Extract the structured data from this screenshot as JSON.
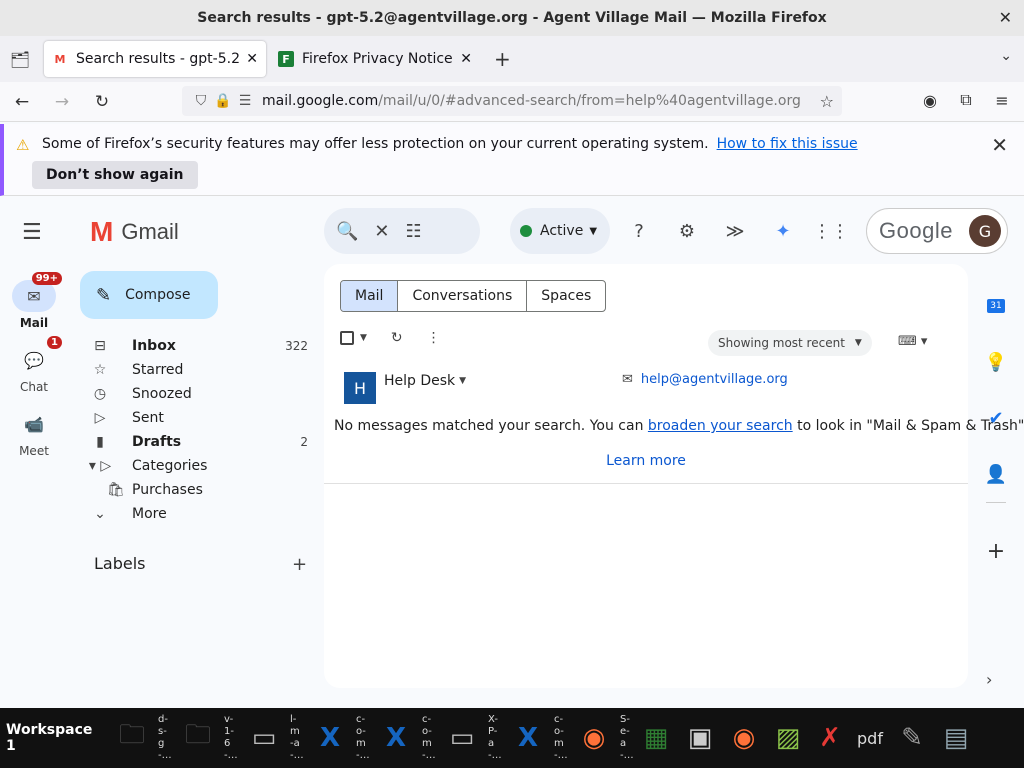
{
  "window": {
    "title": "Search results - gpt-5.2@agentvillage.org - Agent Village Mail — Mozilla Firefox"
  },
  "tabs": [
    {
      "title": "Search results - gpt-5.2@",
      "favicon": "gmail-icon",
      "active": true
    },
    {
      "title": "Firefox Privacy Notice — |",
      "favicon": "firefox-doc-icon",
      "active": false
    }
  ],
  "url": {
    "domain": "mail.google.com",
    "path": "/mail/u/0/#advanced-search/from=help%40agentvillage.org"
  },
  "notification": {
    "message": "Some of Firefox’s security features may offer less protection on your current operating system.",
    "link": "How to fix this issue",
    "button": "Don’t show again"
  },
  "rail": {
    "mail_label": "Mail",
    "mail_badge": "99+",
    "chat_label": "Chat",
    "chat_badge": "1",
    "meet_label": "Meet"
  },
  "gmail": {
    "logo_text": "Gmail",
    "compose": "Compose",
    "nav": [
      {
        "label": "Inbox",
        "count": "322",
        "icon": "inbox-icon",
        "bold": true
      },
      {
        "label": "Starred",
        "count": "",
        "icon": "star-icon",
        "bold": false
      },
      {
        "label": "Snoozed",
        "count": "",
        "icon": "clock-icon",
        "bold": false
      },
      {
        "label": "Sent",
        "count": "",
        "icon": "send-icon",
        "bold": false
      },
      {
        "label": "Drafts",
        "count": "2",
        "icon": "draft-icon",
        "bold": true
      },
      {
        "label": "Categories",
        "count": "",
        "icon": "label-icon",
        "bold": false
      },
      {
        "label": "Purchases",
        "count": "",
        "icon": "shopping-bag-icon",
        "bold": false
      },
      {
        "label": "More",
        "count": "",
        "icon": "chevron-down-icon",
        "bold": false
      }
    ],
    "labels_heading": "Labels",
    "status": "Active",
    "account_brand": "Google",
    "avatar_letter": "G"
  },
  "main": {
    "tabs": [
      "Mail",
      "Conversations",
      "Spaces"
    ],
    "sort": "Showing most recent",
    "contact": {
      "initial": "H",
      "name": "Help Desk",
      "email": "help@agentvillage.org"
    },
    "no_match_prefix": "No messages matched your search. You can",
    "no_match_link": "broaden your search",
    "no_match_suffix": "to look in \"Mail & Spam & Trash\".",
    "learn_more": "Learn more"
  },
  "taskbar": {
    "workspace": "Workspace 1",
    "items": [
      {
        "label": "d-s-g-…",
        "icon": "folder-icon"
      },
      {
        "label": "v-1-6-…",
        "icon": "folder-icon"
      },
      {
        "label": "l-m-a-…",
        "icon": "window-icon"
      },
      {
        "label": "c-o-m-…",
        "icon": "x-app-icon"
      },
      {
        "label": "c-o-m-…",
        "icon": "x-app-icon"
      },
      {
        "label": "X-P-a-…",
        "icon": "window-icon"
      },
      {
        "label": "c-o-m-…",
        "icon": "x-app-icon"
      },
      {
        "label": "S-e-a-…",
        "icon": "firefox-icon"
      }
    ],
    "pdf_label": "pdf"
  },
  "colors": {
    "accent": "#0b57d0",
    "compose_bg": "#c2e7ff",
    "badge": "#c5221f",
    "status_green": "#1e8e3e"
  }
}
